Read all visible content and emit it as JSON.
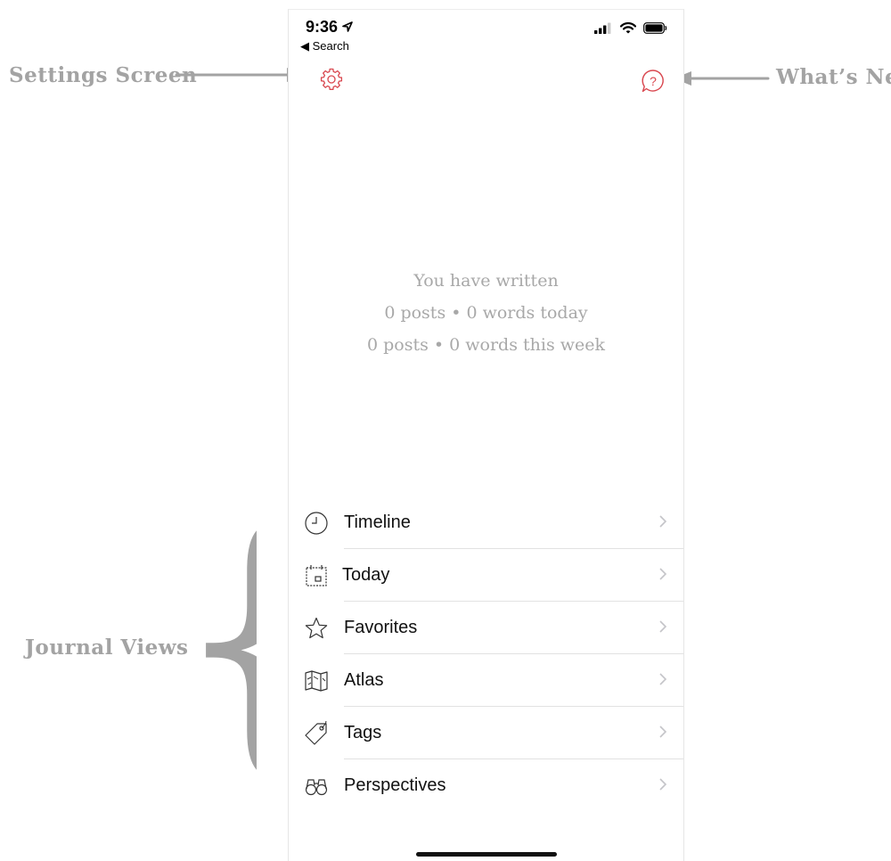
{
  "annotations": {
    "settings": "Settings Screen",
    "whats_new": "What’s New",
    "journal_views": "Journal Views"
  },
  "status_bar": {
    "time": "9:36",
    "back_label": "◀ Search"
  },
  "stats": {
    "heading": "You have written",
    "today": "0 posts • 0 words today",
    "week": "0 posts • 0 words this week"
  },
  "menu": [
    {
      "label": "Timeline",
      "icon": "clock-icon"
    },
    {
      "label": "Today",
      "icon": "calendar-icon"
    },
    {
      "label": "Favorites",
      "icon": "star-icon"
    },
    {
      "label": "Atlas",
      "icon": "map-icon"
    },
    {
      "label": "Tags",
      "icon": "tag-icon"
    },
    {
      "label": "Perspectives",
      "icon": "binoculars-icon"
    }
  ],
  "colors": {
    "accent": "#d9474f",
    "annotation": "#a3a3a3",
    "stats_text": "#a8a8a8"
  }
}
